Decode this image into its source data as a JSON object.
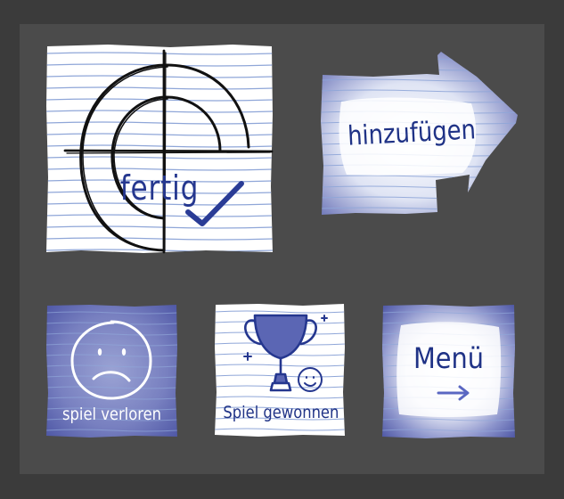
{
  "buttons": {
    "done_label": "fertig",
    "add_label": "hinzufügen",
    "lost_label": "spiel verloren",
    "won_label": "Spiel gewonnen",
    "menu_label": "Menü"
  },
  "colors": {
    "background": "#3b3b3b",
    "panel": "#4b4b4b",
    "paper": "#ffffff",
    "ink_blue": "#25378f",
    "wash_blue": "#6b74b8",
    "ruled_line": "#8fa6d8"
  },
  "icons": {
    "done": "crosshair-check-icon",
    "add": "arrow-right-icon",
    "lost": "sad-face-icon",
    "won": "trophy-icon",
    "menu": "arrow-right-icon"
  }
}
